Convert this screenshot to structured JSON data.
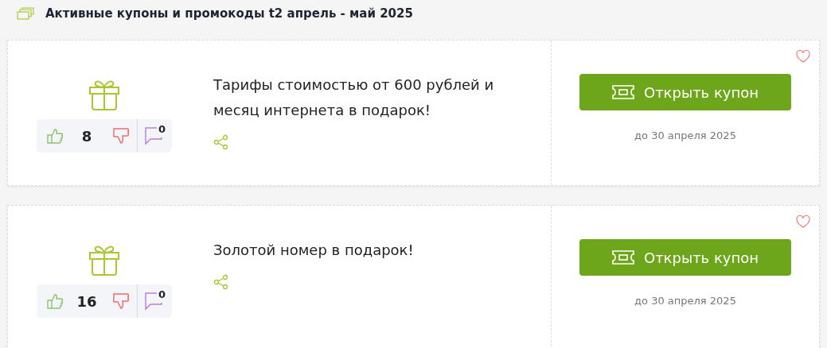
{
  "heading": "Активные купоны и промокоды t2 апрель - май 2025",
  "coupons": [
    {
      "title": "Тарифы стоимостью от 600 рублей и месяц интернета в подарок!",
      "likes": "8",
      "comments": "0",
      "button": "Открыть купон",
      "expires": "до 30 апреля 2025"
    },
    {
      "title": "Золотой номер в подарок!",
      "likes": "16",
      "comments": "0",
      "button": "Открыть купон",
      "expires": "до 30 апреля 2025"
    }
  ]
}
